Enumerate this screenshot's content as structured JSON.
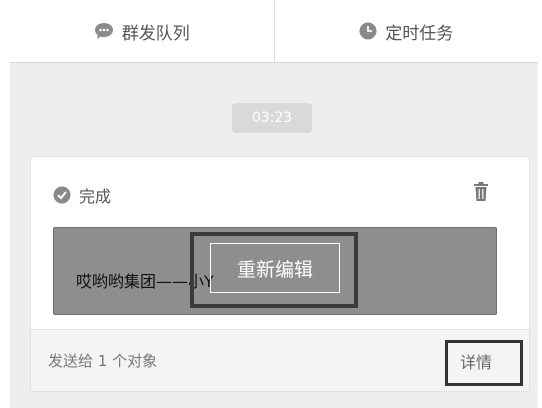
{
  "tabs": [
    {
      "label": "群发队列",
      "icon": "chat-bubble-icon"
    },
    {
      "label": "定时任务",
      "icon": "clock-icon"
    }
  ],
  "timestamp": "03:23",
  "card": {
    "status": "完成",
    "status_icon": "check-circle-icon",
    "message_text": "哎哟哟集团——小Y",
    "edit_label": "重新编辑",
    "send_info": "发送给 1 个对象",
    "detail_label": "详情"
  },
  "colors": {
    "panel_bg": "#eeeeee",
    "preview_bg": "#8e8e8e",
    "time_badge_bg": "#d9d9d9"
  }
}
